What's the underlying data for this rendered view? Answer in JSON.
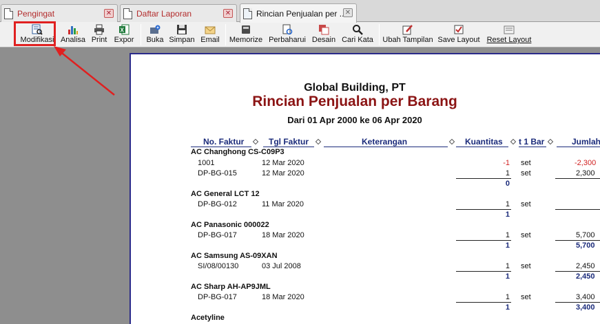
{
  "tabs": [
    {
      "label": "Pengingat"
    },
    {
      "label": "Daftar Laporan"
    },
    {
      "label": "Rincian Penjualan per ..."
    }
  ],
  "toolbar": {
    "buttons": [
      {
        "label": "Modifikasi",
        "icon": "modify-report-icon"
      },
      {
        "label": "Analisa",
        "icon": "bar-chart-icon"
      },
      {
        "label": "Print",
        "icon": "printer-icon"
      },
      {
        "label": "Expor",
        "icon": "excel-export-icon"
      },
      {
        "label": "Buka",
        "icon": "open-folder-icon"
      },
      {
        "label": "Simpan",
        "icon": "save-disk-icon"
      },
      {
        "label": "Email",
        "icon": "envelope-icon"
      },
      {
        "label": "Memorize",
        "icon": "memorize-icon"
      },
      {
        "label": "Perbaharui",
        "icon": "refresh-icon"
      },
      {
        "label": "Desain",
        "icon": "design-icon"
      },
      {
        "label": "Cari Kata",
        "icon": "magnifier-icon"
      },
      {
        "label": "Ubah Tampilan",
        "icon": "edit-pencil-icon"
      },
      {
        "label": "Save Layout",
        "icon": "checkbox-icon"
      },
      {
        "label": "Reset Layout",
        "icon": "reset-layout-icon"
      }
    ]
  },
  "report": {
    "company": "Global Building, PT",
    "title": "Rincian Penjualan per Barang",
    "period": "Dari 01 Apr 2000 ke 06 Apr 2020",
    "columns": [
      "No. Faktur",
      "Tgl Faktur",
      "Keterangan",
      "Kuantitas",
      "t 1 Bar",
      "Jumlah"
    ],
    "groups": [
      {
        "name": "AC Changhong CS-C09P3",
        "rows": [
          {
            "no": "1001",
            "date": "12 Mar 2020",
            "qty": "-1",
            "unit": "set",
            "amount": "-2,300"
          },
          {
            "no": "DP-BG-015",
            "date": "12 Mar 2020",
            "qty": "1",
            "unit": "set",
            "amount": "2,300"
          }
        ],
        "total_qty": "0",
        "total_amount": ""
      },
      {
        "name": "AC General LCT 12",
        "rows": [
          {
            "no": "DP-BG-012",
            "date": "11 Mar 2020",
            "qty": "1",
            "unit": "set",
            "amount": ""
          }
        ],
        "total_qty": "1",
        "total_amount": ""
      },
      {
        "name": "AC Panasonic 000022",
        "rows": [
          {
            "no": "DP-BG-017",
            "date": "18 Mar 2020",
            "qty": "1",
            "unit": "set",
            "amount": "5,700"
          }
        ],
        "total_qty": "1",
        "total_amount": "5,700"
      },
      {
        "name": "AC Samsung AS-09XAN",
        "rows": [
          {
            "no": "SI/08/00130",
            "date": "03 Jul 2008",
            "qty": "1",
            "unit": "set",
            "amount": "2,450"
          }
        ],
        "total_qty": "1",
        "total_amount": "2,450"
      },
      {
        "name": "AC Sharp AH-AP9JML",
        "rows": [
          {
            "no": "DP-BG-017",
            "date": "18 Mar 2020",
            "qty": "1",
            "unit": "set",
            "amount": "3,400"
          }
        ],
        "total_qty": "1",
        "total_amount": "3,400"
      },
      {
        "name": "Acetyline",
        "rows": [],
        "total_qty": "",
        "total_amount": ""
      }
    ]
  },
  "colors": {
    "title_red": "#8b1414",
    "header_blue": "#1a2a7a",
    "negative_red": "#d01e1e",
    "highlight_red": "#e02020"
  }
}
